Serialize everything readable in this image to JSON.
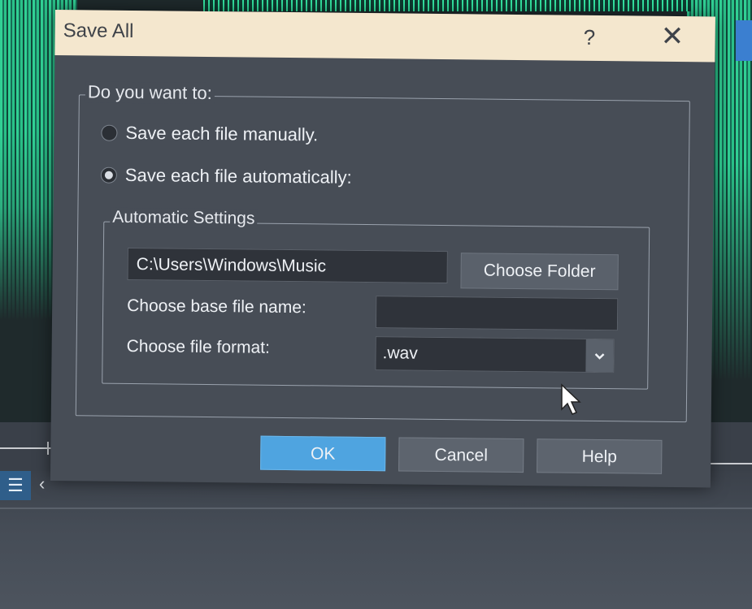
{
  "dialog": {
    "title": "Save All",
    "help_glyph": "?",
    "close_glyph": "✕",
    "question_legend": "Do you want to:",
    "options": [
      {
        "label": "Save each file manually.",
        "checked": false
      },
      {
        "label": "Save each file automatically:",
        "checked": true
      }
    ],
    "automatic_settings": {
      "legend": "Automatic Settings",
      "folder_path": "C:\\Users\\Windows\\Music",
      "choose_folder_label": "Choose Folder",
      "base_name_label": "Choose base file name:",
      "base_name_value": "",
      "format_label": "Choose file format:",
      "format_value": ".wav"
    },
    "buttons": {
      "ok": "OK",
      "cancel": "Cancel",
      "help": "Help"
    }
  },
  "background": {
    "list_icon": "☰",
    "back_icon": "‹"
  },
  "colors": {
    "accent": "#4fa4e0",
    "waveform": "#33e3a0",
    "titlebar": "#f4e7ce",
    "dialog_bg": "#474d56"
  }
}
